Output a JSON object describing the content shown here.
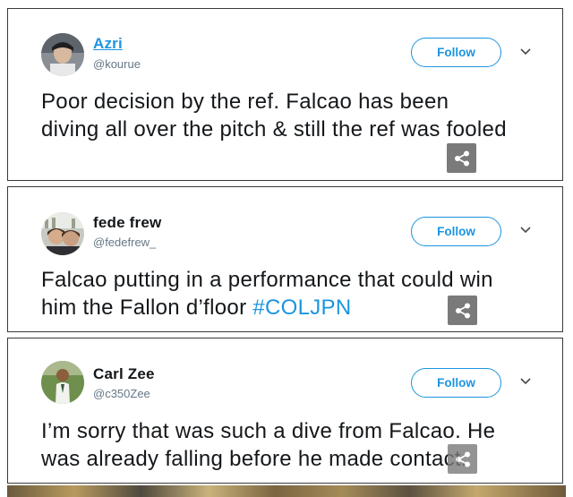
{
  "tweets": [
    {
      "name": "Azri",
      "handle": "@kourue",
      "follow_label": "Follow",
      "text": "Poor decision by the ref. Falcao has been diving all over the pitch & still the ref was fooled",
      "hashtag": ""
    },
    {
      "name": "fede frew",
      "handle": "@fedefrew_",
      "follow_label": "Follow",
      "text": "Falcao putting in a performance that could win him the Fallon d’floor ",
      "hashtag": "#COLJPN"
    },
    {
      "name": "Carl Zee",
      "handle": "@c350Zee",
      "follow_label": "Follow",
      "text": "I’m sorry that was such a dive from Falcao. He was already falling before he made contact.",
      "hashtag": ""
    }
  ],
  "icons": {
    "menu": "chevron-down-icon",
    "share": "share-icon"
  },
  "colors": {
    "link_blue": "#1b95e0",
    "text": "#14171a",
    "handle_grey": "#657786",
    "share_bg": "#7a7a7a"
  }
}
